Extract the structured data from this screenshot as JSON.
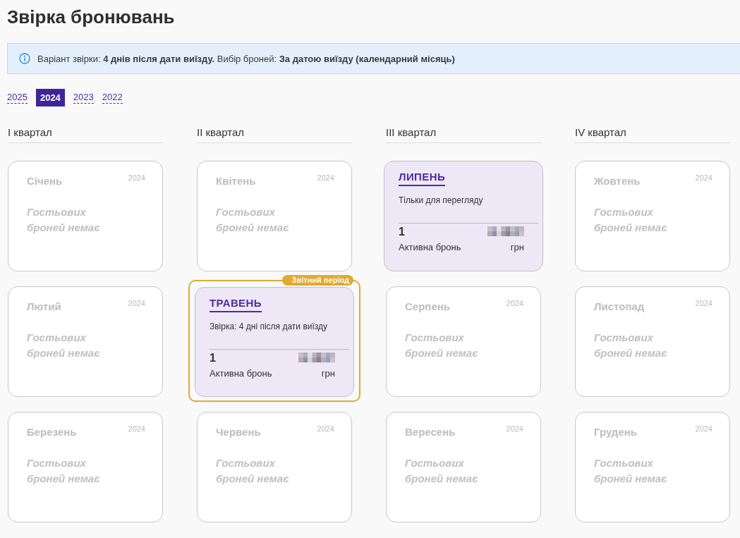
{
  "title": "Звірка бронювань",
  "info_banner": {
    "text": "Варіант звірки: **4 днів після дати виїзду.** Вибір броней: **За датою виїзду (календарний місяць)**"
  },
  "year_tabs": [
    {
      "label": "2025",
      "selected": false
    },
    {
      "label": "2024",
      "selected": true
    },
    {
      "label": "2023",
      "selected": false
    },
    {
      "label": "2022",
      "selected": false
    }
  ],
  "quarters": [
    {
      "title": "I квартал",
      "months": [
        {
          "kind": "empty",
          "name": "Січень",
          "year": "2024",
          "message": "Гостьових броней немає",
          "reporting_period": false
        },
        {
          "kind": "empty",
          "name": "Лютий",
          "year": "2024",
          "message": "Гостьових броней немає",
          "reporting_period": false
        },
        {
          "kind": "empty",
          "name": "Березень",
          "year": "2024",
          "message": "Гостьових броней немає",
          "reporting_period": false
        }
      ]
    },
    {
      "title": "II квартал",
      "months": [
        {
          "kind": "empty",
          "name": "Квітень",
          "year": "2024",
          "message": "Гостьових броней немає",
          "reporting_period": false
        },
        {
          "kind": "active",
          "name": "ТРАВЕНЬ",
          "note": "Звірка: 4 дні після дати виїзду",
          "count": "1",
          "count_label": "Активна бронь",
          "currency": "грн",
          "reporting_period": true,
          "badge": "Звітний період"
        },
        {
          "kind": "empty",
          "name": "Червень",
          "year": "2024",
          "message": "Гостьових броней немає",
          "reporting_period": false
        }
      ]
    },
    {
      "title": "III квартал",
      "months": [
        {
          "kind": "active",
          "name": "ЛИПЕНЬ",
          "note": "Тільки для перегляду",
          "count": "1",
          "count_label": "Активна бронь",
          "currency": "грн",
          "reporting_period": false
        },
        {
          "kind": "empty",
          "name": "Серпень",
          "year": "2024",
          "message": "Гостьових броней немає",
          "reporting_period": false
        },
        {
          "kind": "empty",
          "name": "Вересень",
          "year": "2024",
          "message": "Гостьових броней немає",
          "reporting_period": false
        }
      ]
    },
    {
      "title": "IV квартал",
      "months": [
        {
          "kind": "empty",
          "name": "Жовтень",
          "year": "2024",
          "message": "Гостьових броней немає",
          "reporting_period": false
        },
        {
          "kind": "empty",
          "name": "Листопад",
          "year": "2024",
          "message": "Гостьових броней немає",
          "reporting_period": false
        },
        {
          "kind": "empty",
          "name": "Грудень",
          "year": "2024",
          "message": "Гостьових броней немає",
          "reporting_period": false
        }
      ]
    }
  ]
}
